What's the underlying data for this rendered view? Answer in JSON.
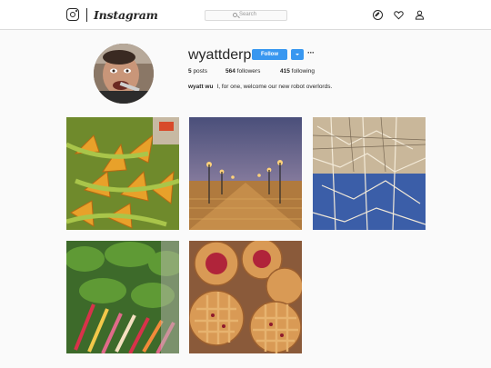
{
  "header": {
    "wordmark": "Instagram",
    "search_placeholder": "Search",
    "icons": [
      "instagram-glyph-icon",
      "compass-icon",
      "heart-icon",
      "person-icon"
    ]
  },
  "profile": {
    "username": "wyattderp",
    "follow_label": "Follow",
    "more_label": "···",
    "stats": {
      "posts_count": "5",
      "posts_label": "posts",
      "followers_count": "564",
      "followers_label": "followers",
      "following_count": "415",
      "following_label": "following"
    },
    "bio_name": "wyatt wu",
    "bio_text": "I, for one, welcome our new robot overlords."
  },
  "colors": {
    "accent": "#3897f0",
    "text": "#262626",
    "background": "#fafafa",
    "border": "#dbdbdb"
  },
  "posts": [
    {
      "subject": "squash blossoms"
    },
    {
      "subject": "pier at dusk"
    },
    {
      "subject": "toothpick city sculpture"
    },
    {
      "subject": "rainbow chard"
    },
    {
      "subject": "pies"
    }
  ]
}
